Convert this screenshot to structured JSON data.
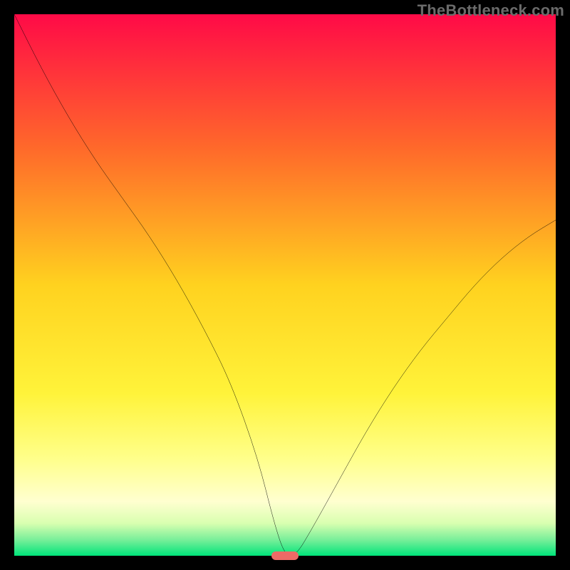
{
  "watermark": "TheBottleneck.com",
  "chart_data": {
    "type": "line",
    "title": "",
    "xlabel": "",
    "ylabel": "",
    "xlim": [
      0,
      100
    ],
    "ylim": [
      0,
      100
    ],
    "gradient_stops": [
      {
        "offset": 0,
        "color": "#ff0a47"
      },
      {
        "offset": 25,
        "color": "#ff6a2a"
      },
      {
        "offset": 50,
        "color": "#ffd21f"
      },
      {
        "offset": 70,
        "color": "#fff33a"
      },
      {
        "offset": 82,
        "color": "#ffff8a"
      },
      {
        "offset": 90,
        "color": "#ffffd0"
      },
      {
        "offset": 94,
        "color": "#d9ffb0"
      },
      {
        "offset": 97,
        "color": "#7aef9a"
      },
      {
        "offset": 100,
        "color": "#00e47a"
      }
    ],
    "series": [
      {
        "name": "bottleneck-curve",
        "x": [
          0,
          5,
          10,
          15,
          20,
          25,
          30,
          35,
          40,
          45,
          48,
          50,
          52,
          55,
          60,
          65,
          70,
          75,
          80,
          85,
          90,
          95,
          100
        ],
        "y": [
          100,
          90,
          81,
          73,
          66,
          59,
          51,
          42,
          32,
          18,
          6,
          0,
          0,
          5,
          14,
          23,
          31,
          38,
          44,
          50,
          55,
          59,
          62
        ]
      }
    ],
    "marker": {
      "x": 50,
      "y": 0,
      "width_pct": 5.0,
      "height_pct": 1.6,
      "color": "#ed6a66"
    }
  }
}
